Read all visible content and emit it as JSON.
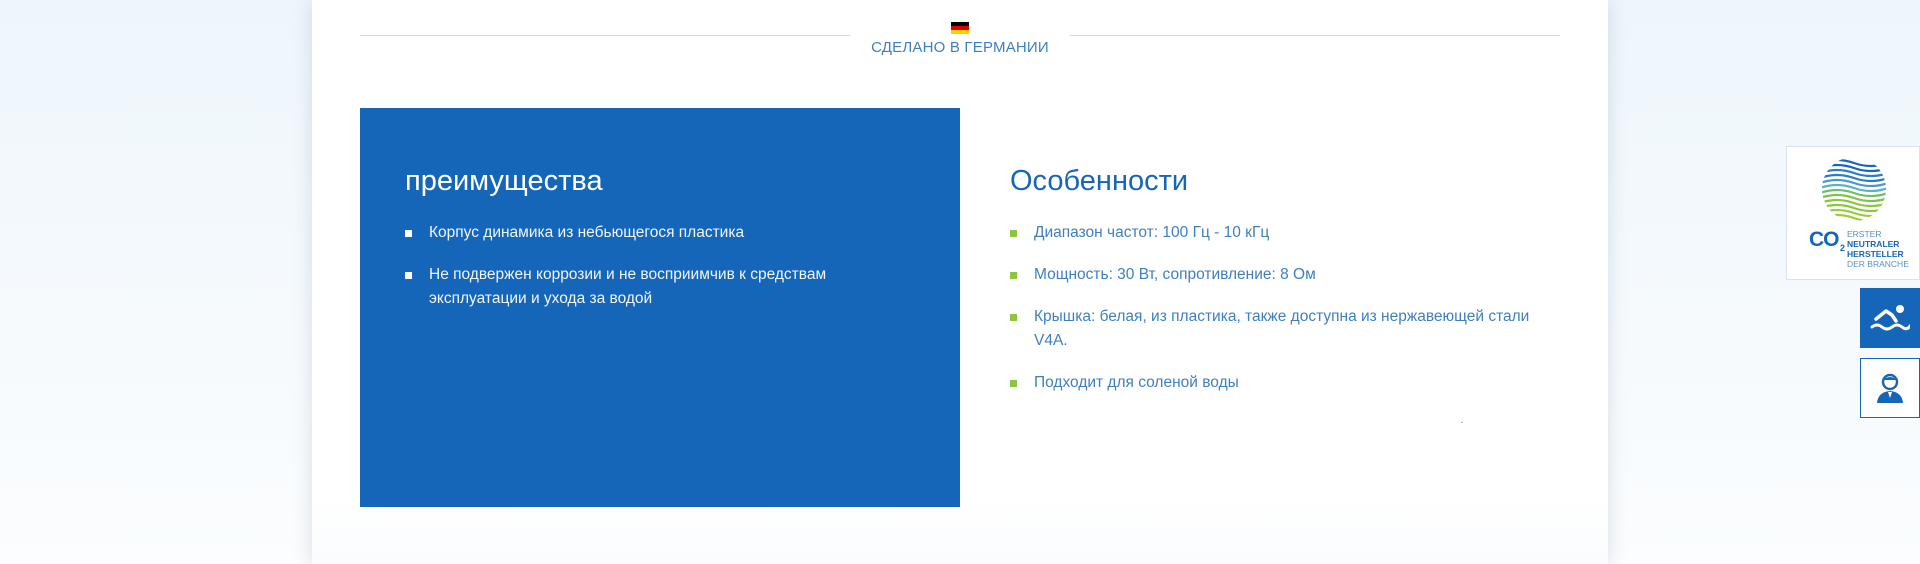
{
  "made_in": {
    "flag_icon": "germany-flag-icon",
    "label": "СДЕЛАНО В ГЕРМАНИИ"
  },
  "advantages": {
    "title": "преимущества",
    "items": [
      "Корпус динамика из небьющегося пластика",
      "Не подвержен коррозии и не восприимчив к средствам эксплуатации и ухода за водой"
    ]
  },
  "features": {
    "title": "Особенности",
    "items": [
      "Диапазон частот: 100 Гц - 10 кГц",
      "Мощность: 30 Вт, сопротивление: 8 Ом",
      "Крышка: белая, из пластика, также доступна из нержавеющей стали V4A.",
      "Подходит для соленой воды"
    ]
  },
  "co2_badge": {
    "co": "CO",
    "sub": "2",
    "line1": "ERSTER",
    "line2": "NEUTRALER",
    "line3": "HERSTELLER",
    "line4": "DER BRANCHE"
  },
  "side_buttons": [
    {
      "icon": "swimmer-icon"
    },
    {
      "icon": "user-contact-icon"
    }
  ],
  "colors": {
    "brand_blue": "#1566b9",
    "text_blue": "#3f7fbf",
    "accent_green": "#8cc63f"
  }
}
